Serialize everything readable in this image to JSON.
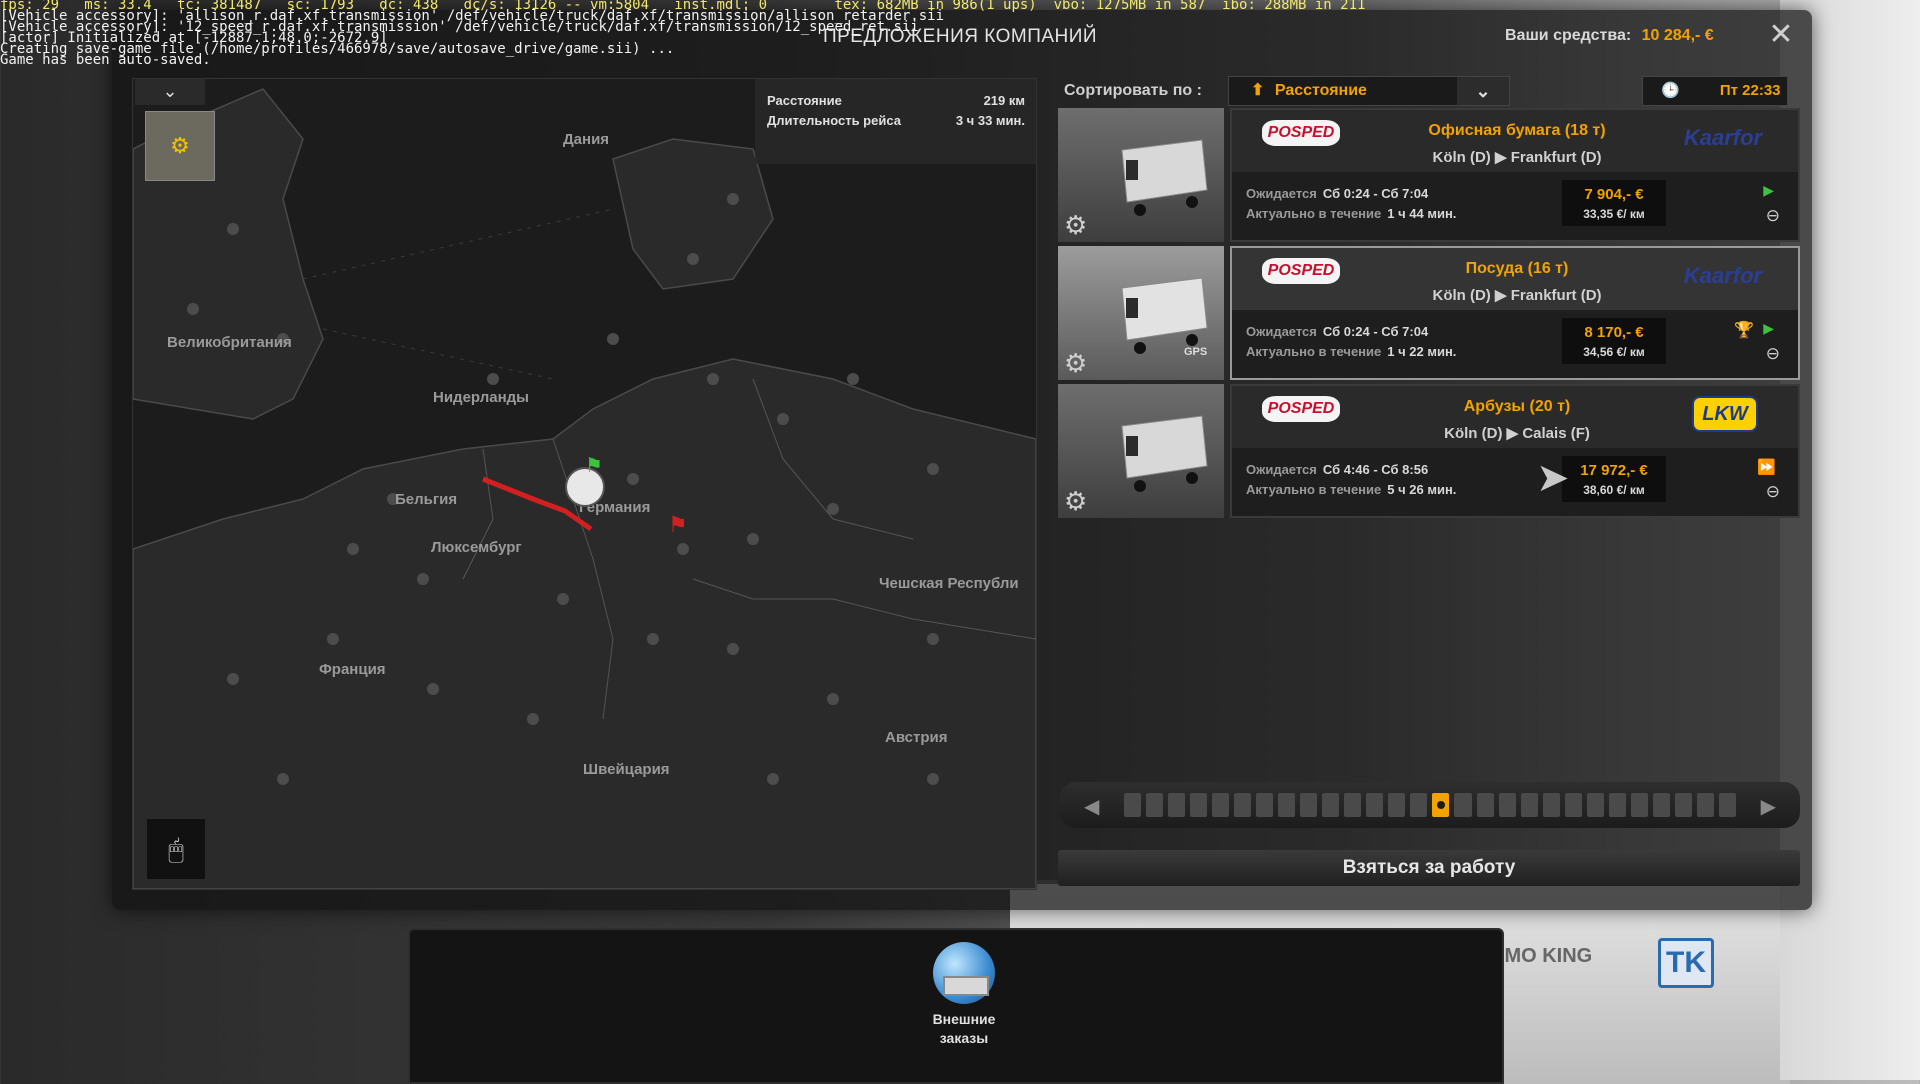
{
  "console": {
    "line1": "fps: 29   ms: 33.4   tc: 381487   sc: 1793   dc: 438   dc/s: 13126 -- vm:5804   inst.mdl: 0        tex: 682MB in 986(1 ups)  vbo: 1275MB in 587  ibo: 288MB in 211",
    "line2": "[Vehicle accessory]: 'allison_r.daf.xf.transmission' /def/vehicle/truck/daf.xf/transmission/allison_retarder.sii",
    "line3": "[Vehicle accessory]: '12_speed_r.daf.xf.transmission' /def/vehicle/truck/daf.xf/transmission/12_speed_ret.sii",
    "line4": "[actor] Initialized at [-12887.1;48.0;-2672.9]",
    "line5": "Creating save-game file (/home/profiles/466978/save/autosave_drive/game.sii) ...",
    "line6": "Game has been auto-saved."
  },
  "header": {
    "title": "ПРЕДЛОЖЕНИЯ КОМПАНИЙ",
    "funds_label": "Ваши средства:",
    "funds_value": "10 284,- €",
    "close_icon": "close-icon"
  },
  "map": {
    "info": {
      "distance_label": "Расстояние",
      "distance_value": "219 км",
      "duration_label": "Длительность рейса",
      "duration_value": "3 ч 33 мин."
    },
    "labels": {
      "denmark": "Дания",
      "uk": "Великобритания",
      "netherlands": "Нидерланды",
      "belgium": "Бельгия",
      "germany": "Германия",
      "luxembourg": "Люксембург",
      "czech": "Чешская Республи",
      "france": "Франция",
      "austria": "Австрия",
      "switzerland": "Швейцария"
    }
  },
  "sort": {
    "label": "Сортировать по :",
    "value": "Расстояние"
  },
  "clock": {
    "value": "Пт 22:33"
  },
  "jobs": [
    {
      "sender": "POSPED",
      "cargo": "Офисная бумага (18 т)",
      "route_from": "Köln (D)",
      "route_to": "Frankfurt (D)",
      "company": "Kaarfor",
      "waits_label": "Ожидается",
      "waits_value": "Сб 0:24 - Сб 7:04",
      "valid_label": "Актуально в течение",
      "valid_value": "1 ч 44 мин.",
      "price": "7 904,- €",
      "rate": "33,35 €/ км"
    },
    {
      "sender": "POSPED",
      "cargo": "Посуда (16 т)",
      "route_from": "Köln (D)",
      "route_to": "Frankfurt (D)",
      "company": "Kaarfor",
      "waits_label": "Ожидается",
      "waits_value": "Сб 0:24 - Сб 7:04",
      "valid_label": "Актуально в течение",
      "valid_value": "1 ч 22 мин.",
      "price": "8 170,- €",
      "rate": "34,56 €/ км",
      "gps": "GPS"
    },
    {
      "sender": "POSPED",
      "cargo": "Арбузы (20 т)",
      "route_from": "Köln (D)",
      "route_to": "Calais (F)",
      "company": "LKW",
      "waits_label": "Ожидается",
      "waits_value": "Сб 4:46 - Сб 8:56",
      "valid_label": "Актуально в течение",
      "valid_value": "5 ч 26 мин.",
      "price": "17 972,- €",
      "rate": "38,60 €/ км"
    }
  ],
  "timeline": {
    "segments": 28,
    "active_index": 14
  },
  "take_button": "Взяться за работу",
  "bottom": {
    "ext_orders_line1": "Внешние",
    "ext_orders_line2": "заказы"
  },
  "background": {
    "thermo": "THERMO KING",
    "tk": "TK"
  },
  "colors": {
    "accent": "#f2a300",
    "route": "#d22020",
    "posped": "#c8102e"
  }
}
